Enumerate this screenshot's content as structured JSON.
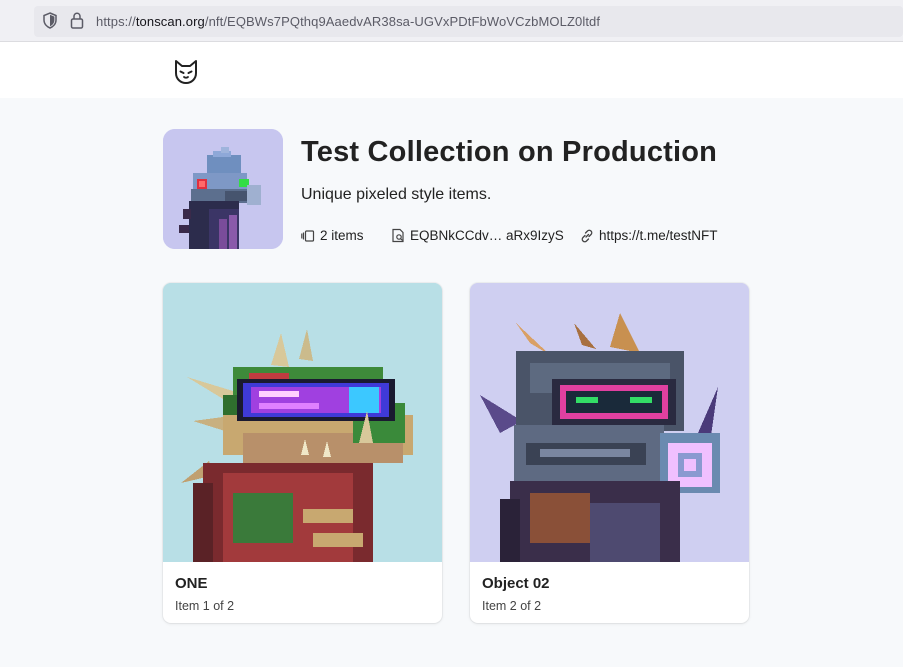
{
  "browser": {
    "url_prefix": "https://",
    "url_host": "tonscan.org",
    "url_path": "/nft/EQBWs7PQthq9AaedvAR38sa-UGVxPDtFbWoVCzbMOLZ0ltdf"
  },
  "collection": {
    "title": "Test Collection on Production",
    "description": "Unique pixeled style items.",
    "items_count": "2 items",
    "owner_address": "EQBNkCCdv… aRx9IzyS",
    "link": "https://t.me/testNFT"
  },
  "items": [
    {
      "name": "ONE",
      "position": "Item 1 of 2"
    },
    {
      "name": "Object 02",
      "position": "Item 2 of 2"
    }
  ]
}
